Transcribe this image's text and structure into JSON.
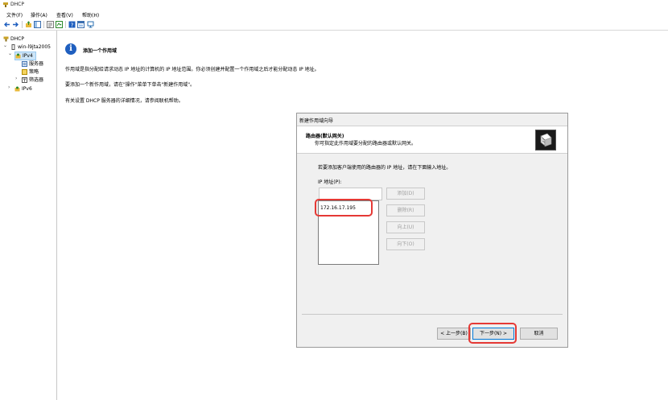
{
  "window": {
    "title": "DHCP"
  },
  "menu": [
    {
      "label": "文件(F)"
    },
    {
      "label": "操作(A)"
    },
    {
      "label": "查看(V)"
    },
    {
      "label": "帮助(H)"
    }
  ],
  "toolbar": {
    "buttons": [
      "back-icon",
      "forward-icon",
      "up-folder-icon",
      "show-tree-icon",
      "refresh-icon",
      "export-icon",
      "help-icon",
      "properties-icon",
      "server-icon"
    ]
  },
  "tree": {
    "root": "DHCP",
    "server": "win-l9jta2005",
    "ipv4": "IPv4",
    "children": [
      "服务器",
      "策略",
      "筛选器"
    ],
    "ipv6": "IPv6"
  },
  "content": {
    "title": "添加一个作用域",
    "para1": "作用域是指分配给请求动态 IP 地址的计算机的 IP 地址范围。你必须创建并配置一个作用域之后才能分配动态 IP 地址。",
    "para2": "要添加一个新作用域，请在\"操作\"菜单下单击\"新建作用域\"。",
    "para3": "有关设置 DHCP 服务器的详细情况，请参阅联机帮助。"
  },
  "wizard": {
    "title": "新建作用域向导",
    "header_title": "路由器(默认网关)",
    "header_subtitle": "你可指定此作用域要分配的路由器或默认网关。",
    "instruction": "若要添加客户端使用的路由器的 IP 地址，请在下面输入地址。",
    "ip_label": "IP 地址(P):",
    "ip_input_value": "",
    "ip_list": [
      "172.16.17.195"
    ],
    "buttons": {
      "add": "添加(D)",
      "remove": "删除(R)",
      "up": "向上(U)",
      "down": "向下(O)",
      "back": "< 上一步(B)",
      "next": "下一步(N) >",
      "cancel": "取消"
    }
  },
  "colors": {
    "highlight": "#e53935",
    "accent": "#1f5fbf"
  }
}
